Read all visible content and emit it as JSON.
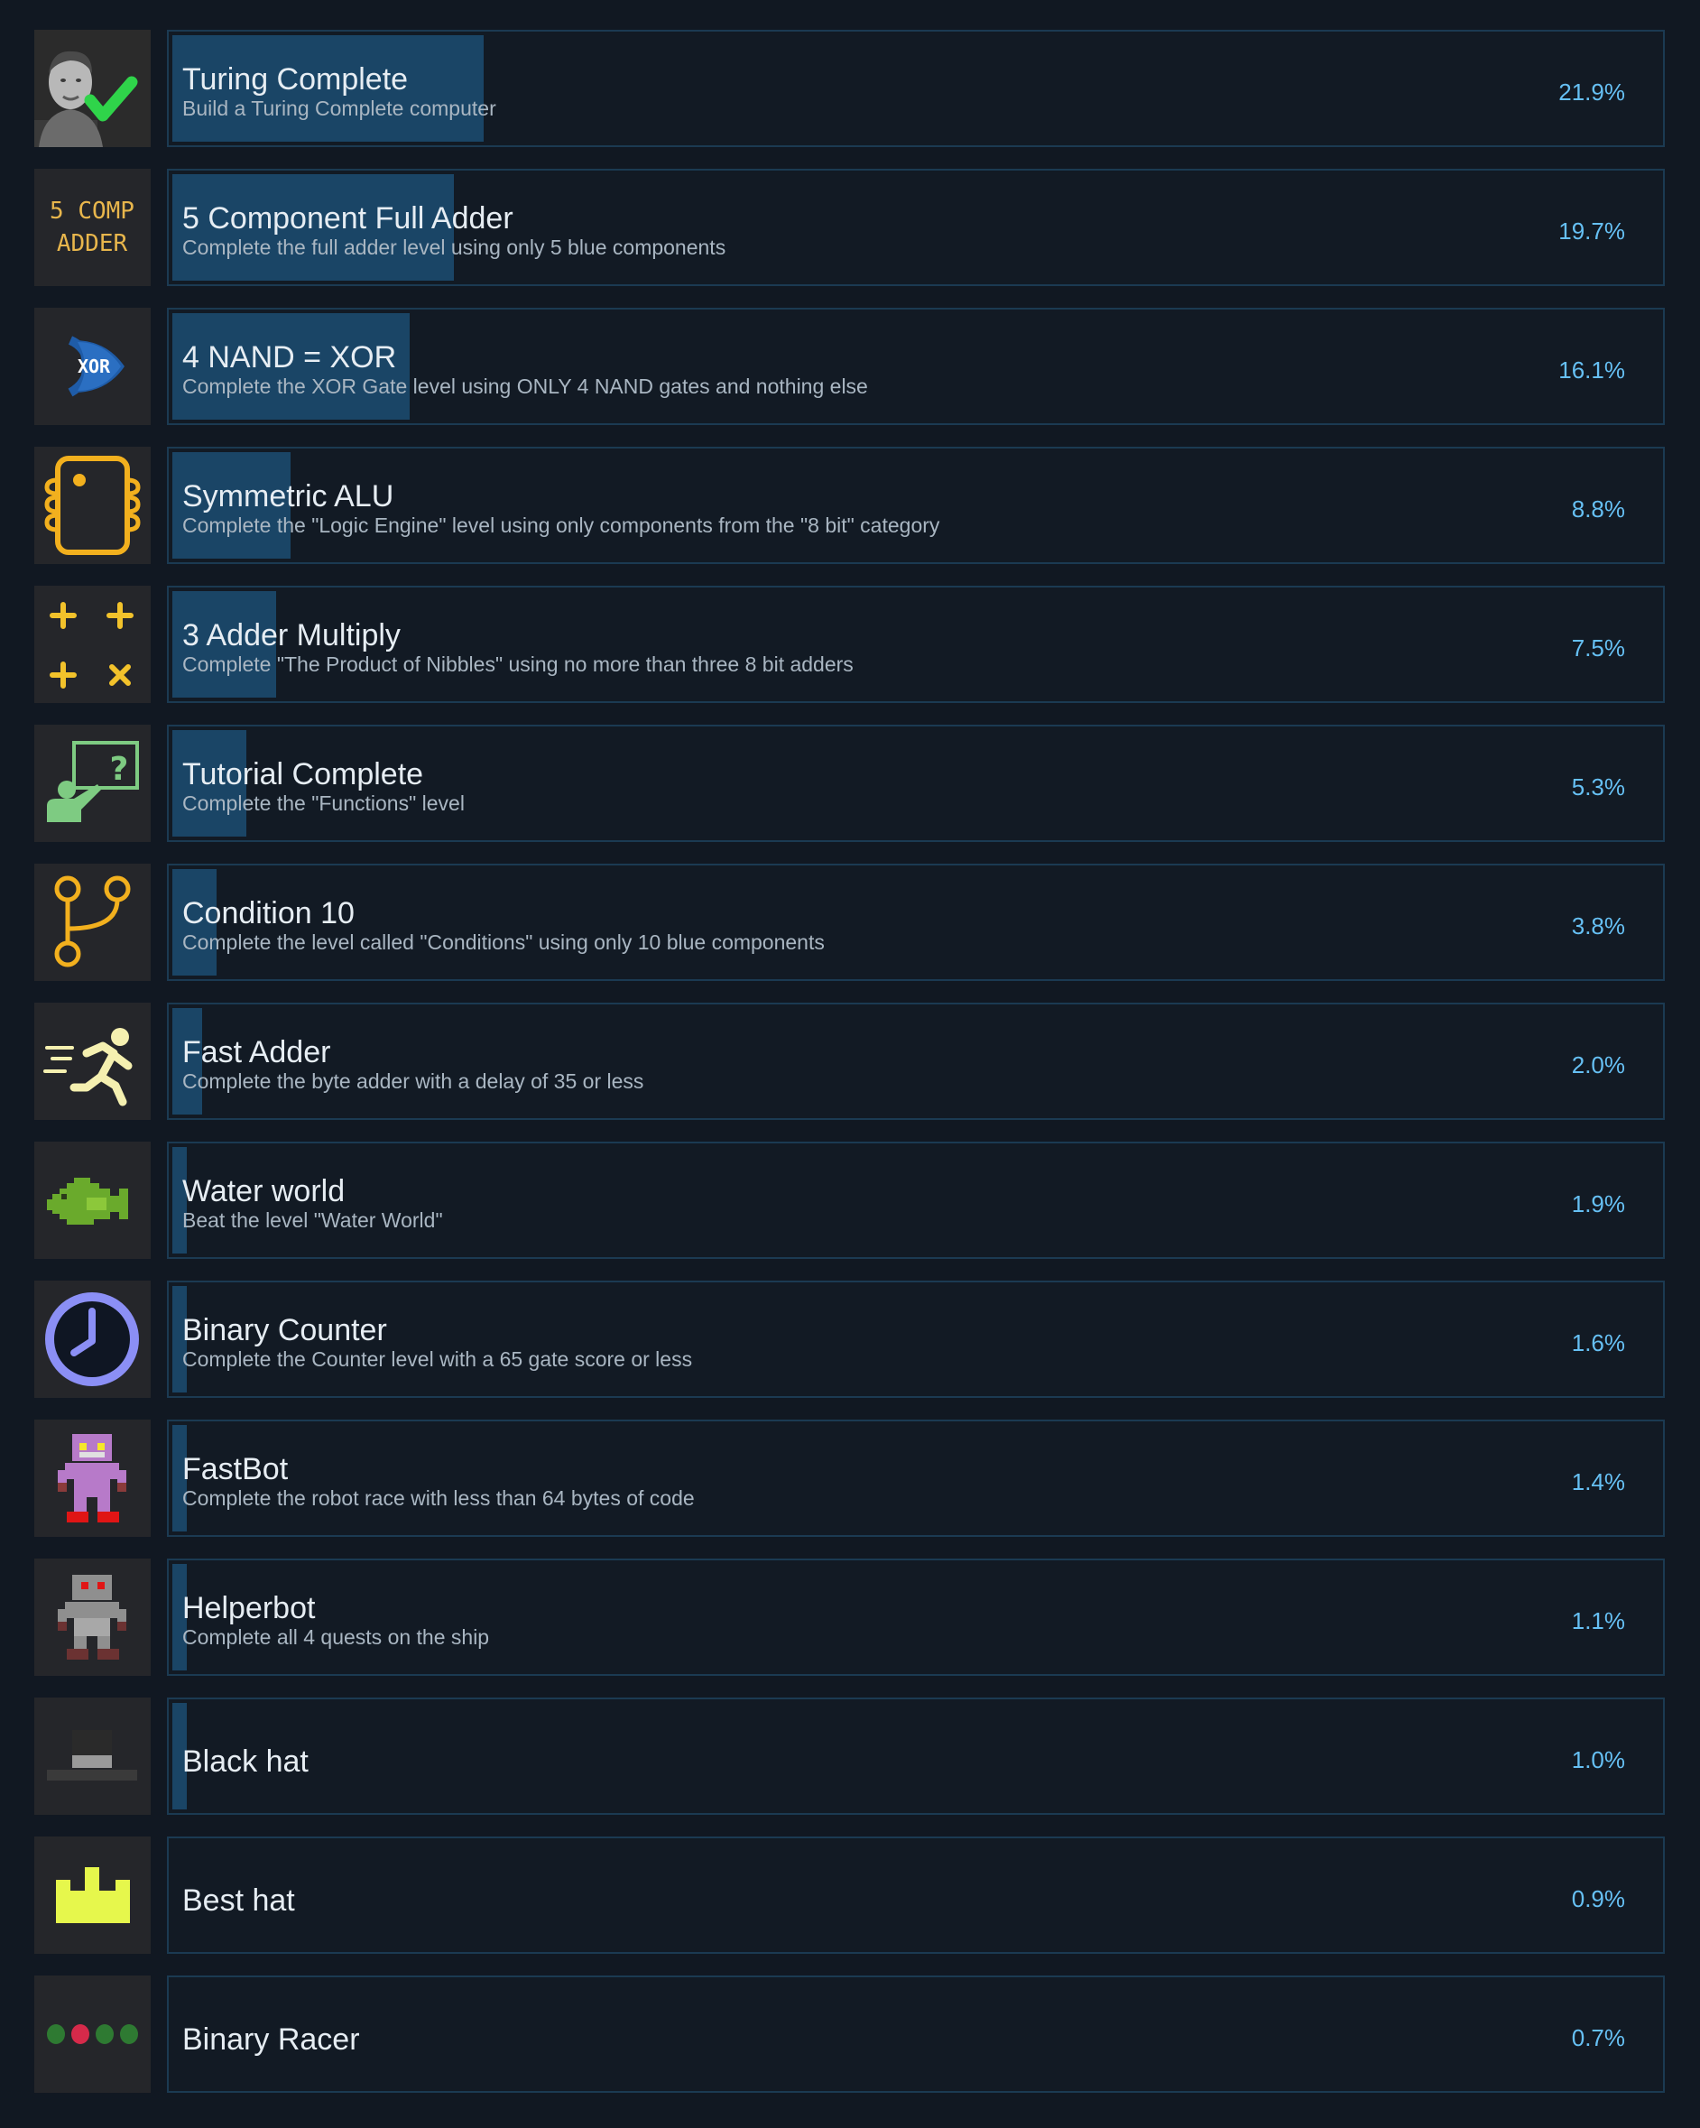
{
  "achievements": [
    {
      "title": "Turing Complete",
      "description": "Build a Turing Complete computer",
      "percent_label": "21.9%",
      "percent": 21.9,
      "icon": "turing-portrait-checkmark-icon"
    },
    {
      "title": "5 Component Full Adder",
      "description": "Complete the full adder level using only 5 blue components",
      "percent_label": "19.7%",
      "percent": 19.7,
      "icon": "5-comp-adder-icon",
      "icon_text": [
        "5 COMP",
        "ADDER"
      ]
    },
    {
      "title": "4 NAND = XOR",
      "description": "Complete the XOR Gate level using ONLY 4 NAND gates and nothing else",
      "percent_label": "16.1%",
      "percent": 16.1,
      "icon": "xor-gate-icon",
      "icon_text": [
        "XOR"
      ]
    },
    {
      "title": "Symmetric ALU",
      "description": "Complete the \"Logic Engine\" level using only components from the \"8 bit\" category",
      "percent_label": "8.8%",
      "percent": 8.8,
      "icon": "chip-icon"
    },
    {
      "title": "3 Adder Multiply",
      "description": "Complete \"The Product of Nibbles\" using no more than three 8 bit adders",
      "percent_label": "7.5%",
      "percent": 7.5,
      "icon": "plus-plus-plus-times-icon"
    },
    {
      "title": "Tutorial Complete",
      "description": "Complete the \"Functions\" level",
      "percent_label": "5.3%",
      "percent": 5.3,
      "icon": "teacher-board-question-icon"
    },
    {
      "title": "Condition 10",
      "description": "Complete the level called \"Conditions\" using only 10 blue components",
      "percent_label": "3.8%",
      "percent": 3.8,
      "icon": "branch-icon"
    },
    {
      "title": "Fast Adder",
      "description": "Complete the byte adder with a delay of 35 or less",
      "percent_label": "2.0%",
      "percent": 2.0,
      "icon": "running-person-icon"
    },
    {
      "title": "Water world",
      "description": "Beat the level \"Water World\"",
      "percent_label": "1.9%",
      "percent": 1.9,
      "icon": "green-fish-icon"
    },
    {
      "title": "Binary Counter",
      "description": "Complete the Counter level with a 65 gate score or less",
      "percent_label": "1.6%",
      "percent": 1.6,
      "icon": "clock-icon"
    },
    {
      "title": "FastBot",
      "description": "Complete the robot race with less than 64 bytes of code",
      "percent_label": "1.4%",
      "percent": 1.4,
      "icon": "purple-robot-icon"
    },
    {
      "title": "Helperbot",
      "description": "Complete all 4 quests on the ship",
      "percent_label": "1.1%",
      "percent": 1.1,
      "icon": "grey-robot-icon"
    },
    {
      "title": "Black hat",
      "description": "",
      "percent_label": "1.0%",
      "percent": 1.0,
      "icon": "black-hat-icon"
    },
    {
      "title": "Best hat",
      "description": "",
      "percent_label": "0.9%",
      "percent": 0.9,
      "icon": "crown-icon"
    },
    {
      "title": "Binary Racer",
      "description": "",
      "percent_label": "0.7%",
      "percent": 0.7,
      "icon": "race-lights-icon"
    }
  ],
  "colors": {
    "background": "#111822",
    "panel_border": "#1b3a52",
    "progress_fill": "#1a4566",
    "percent_text": "#66c0f4",
    "title_text": "#e6edf3",
    "description_text": "#a9b6c2"
  }
}
